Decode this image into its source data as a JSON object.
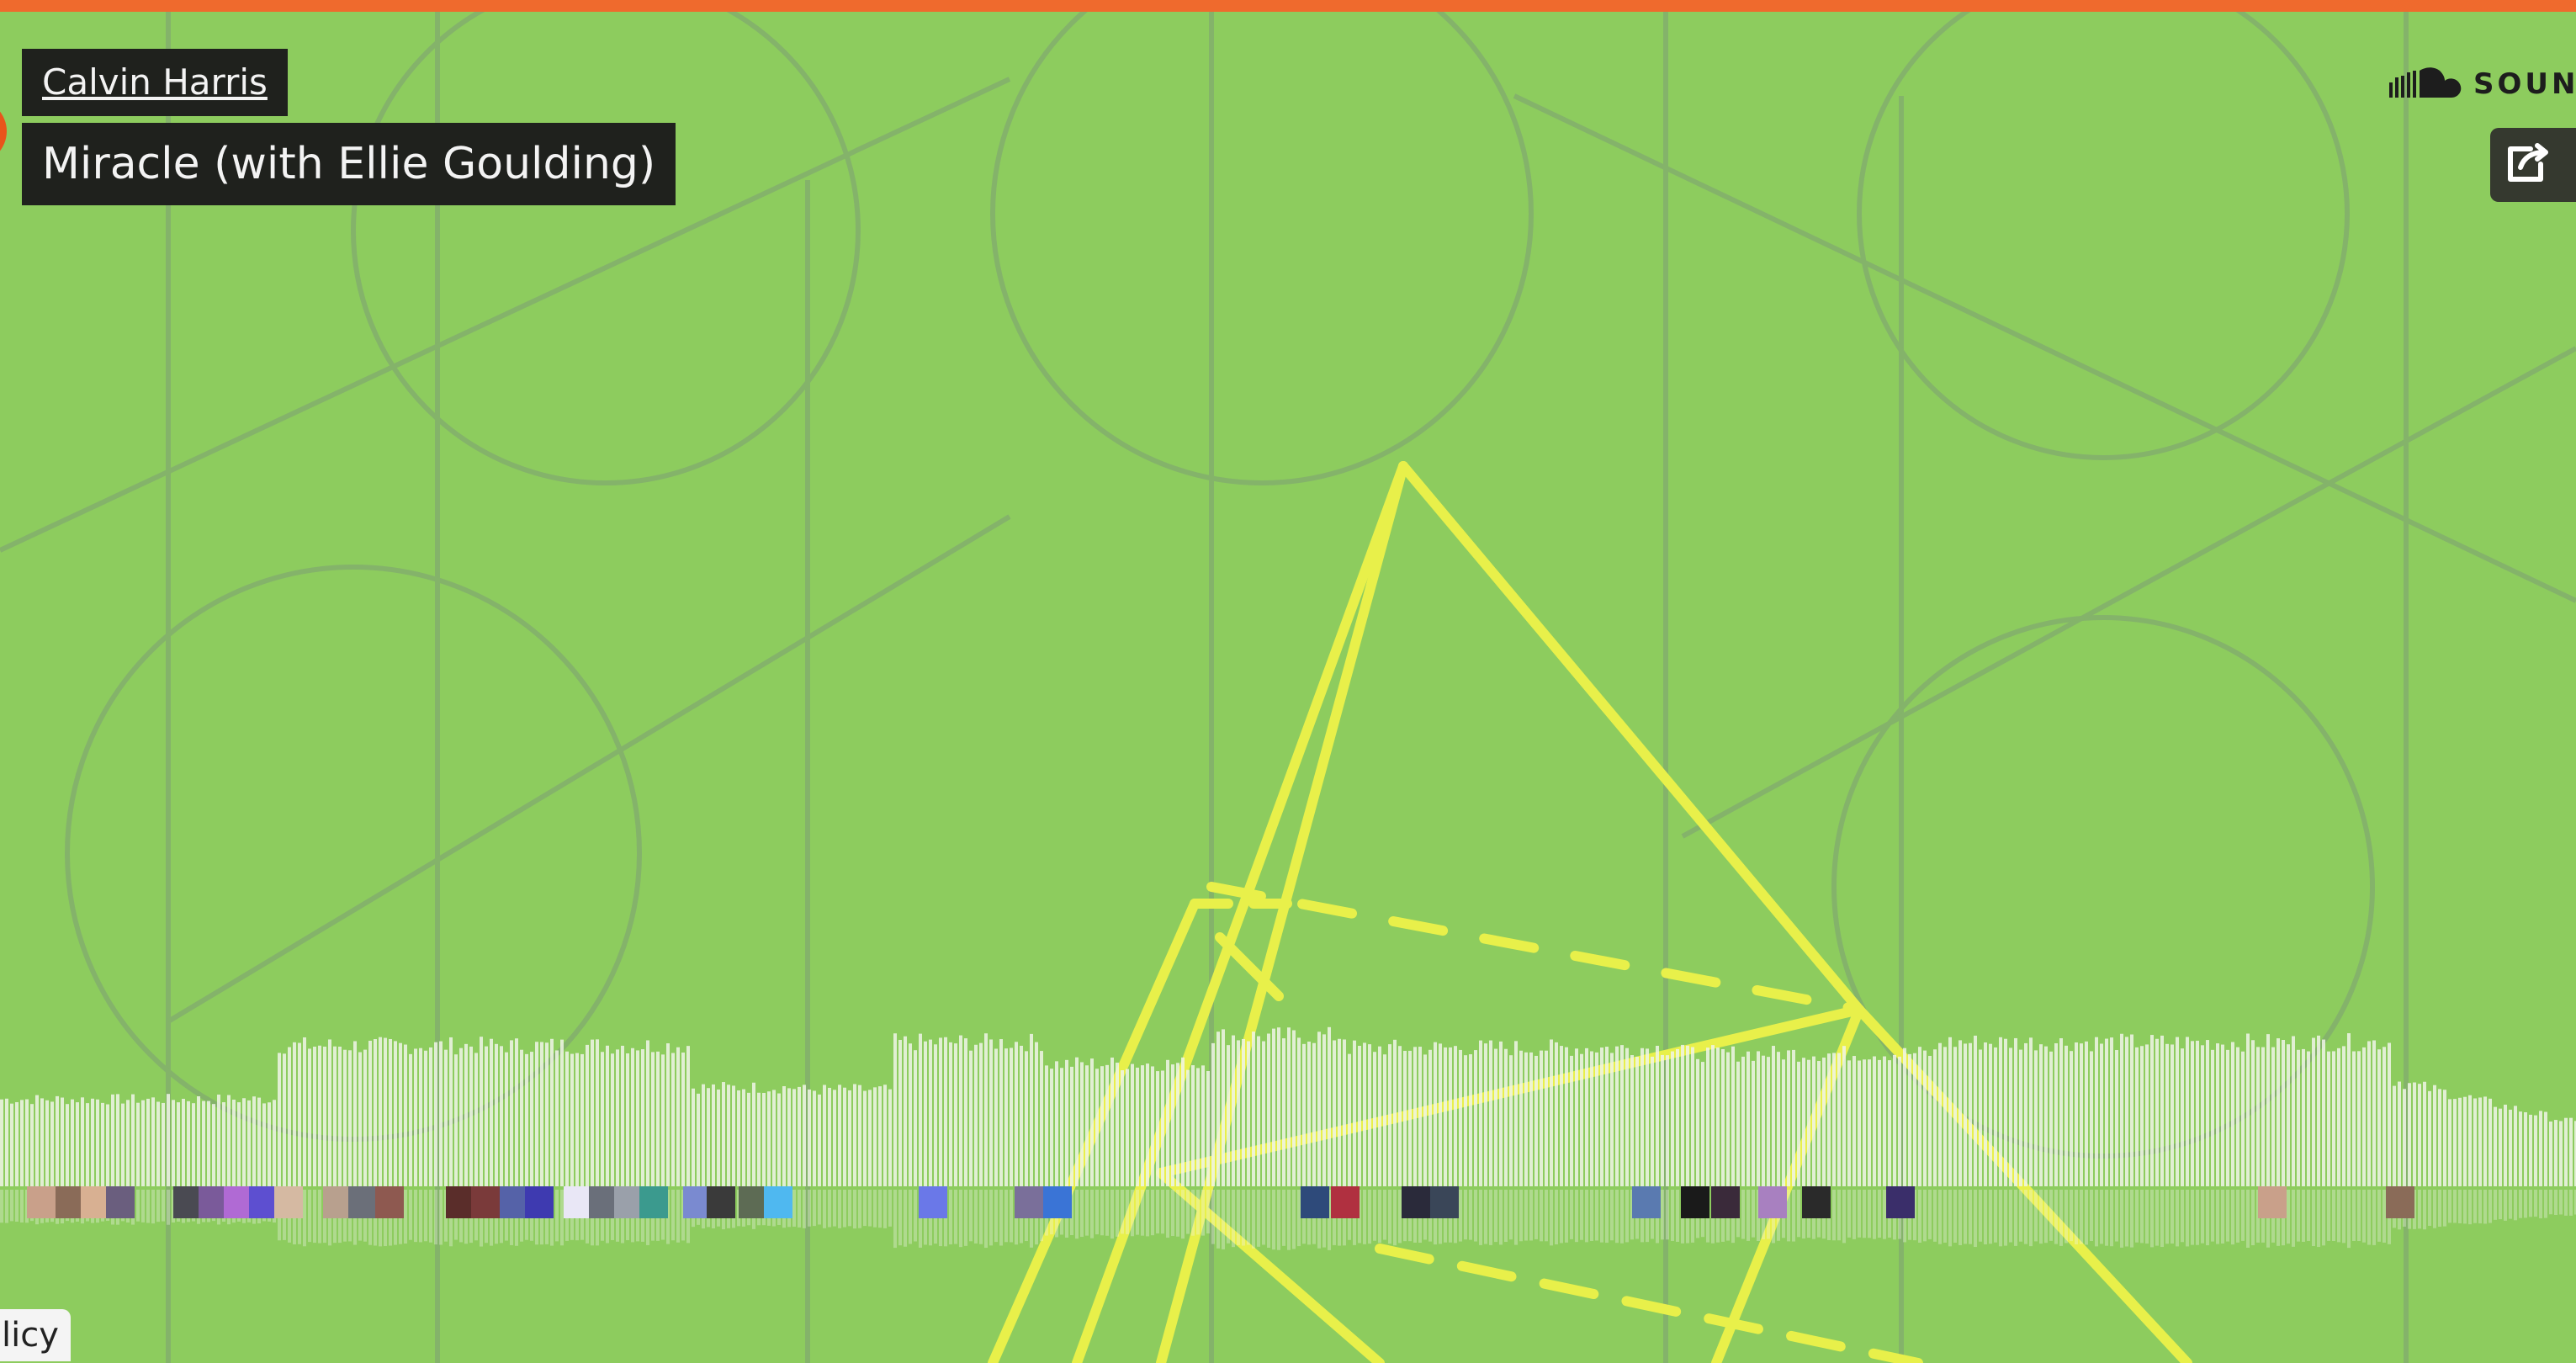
{
  "header": {
    "artist": "Calvin Harris",
    "track": "Miracle (with Ellie Goulding)"
  },
  "brand": {
    "wordmark": "SOUN",
    "icon": "soundcloud-cloud-icon"
  },
  "share": {
    "icon": "share-icon"
  },
  "cookie_link": "licy",
  "colors": {
    "accent": "#ef6a2d",
    "background": "#8dcc5e",
    "pyramid": "#e8f04a",
    "waveform": "#f0f4e8",
    "label_bg": "#1f211d"
  },
  "comment_avatar_colors": [
    "#c9a08a",
    "#8a6b58",
    "#d8b092",
    "#6a5e7e",
    "#4a4a52",
    "#7a5a9a",
    "#b06ad4",
    "#5d4fd0",
    "#d5b9a2",
    "#b8a08e",
    "#6b6f79",
    "#8e5950",
    "#5a2d2a",
    "#7a3a3a",
    "#5562a8",
    "#3e3ab0",
    "#e9e7f6",
    "#6a6f7a",
    "#9aa0aa",
    "#3b9a8e",
    "#7a8ad0",
    "#3a3a3a",
    "#5d6b54",
    "#4fb8f0",
    "#6a78e8",
    "#7a6f9a",
    "#3a74d6",
    "#2e4a7a",
    "#b03040",
    "#2a2a3a",
    "#3a4658",
    "#5a7ab0",
    "#1a1a1a",
    "#3a2a3a",
    "#a880c0",
    "#2a2a2a",
    "#3a2e6a"
  ]
}
